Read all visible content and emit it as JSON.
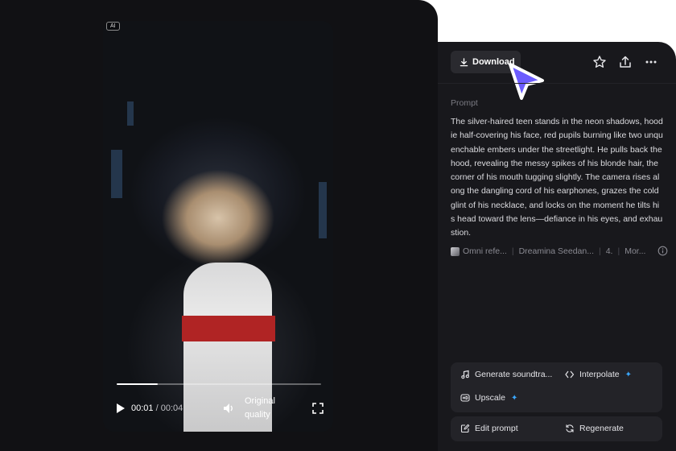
{
  "video": {
    "ai_badge": "AI",
    "progress": 0.2,
    "current_time": "00:01",
    "separator": "/",
    "duration": "00:04",
    "quality": "Original quality",
    "icons": [
      "play-icon",
      "volume-icon",
      "fullscreen-icon"
    ]
  },
  "toolbar": {
    "download_label": "Download",
    "icons": [
      "download-icon",
      "star-icon",
      "share-icon",
      "more-icon"
    ]
  },
  "prompt": {
    "label": "Prompt",
    "text": "The silver-haired teen stands in the neon shadows, hoodie half-covering his face, red pupils burning like two unquenchable embers under the streetlight. He pulls back the hood, revealing the messy spikes of his blonde hair, the corner of his mouth tugging slightly. The camera rises along the dangling cord of his earphones, grazes the cold glint of his necklace, and locks on the moment he tilts his head toward the lens—defiance in his eyes, and exhaustion."
  },
  "meta": {
    "reference": "Omni refe...",
    "model": "Dreamina Seedan...",
    "version": "4.",
    "more": "Mor...",
    "separator": "|"
  },
  "tools": {
    "generate_soundtrack": "Generate soundtra...",
    "interpolate": "Interpolate",
    "upscale": "Upscale",
    "sparkle": "✦",
    "edit_prompt": "Edit prompt",
    "regenerate": "Regenerate"
  },
  "colors": {
    "panel_dark": "#111114",
    "panel": "#18181c",
    "card": "#232328",
    "cursor": "#6c5cff",
    "accent_sparkle": "#3aa8ff"
  }
}
